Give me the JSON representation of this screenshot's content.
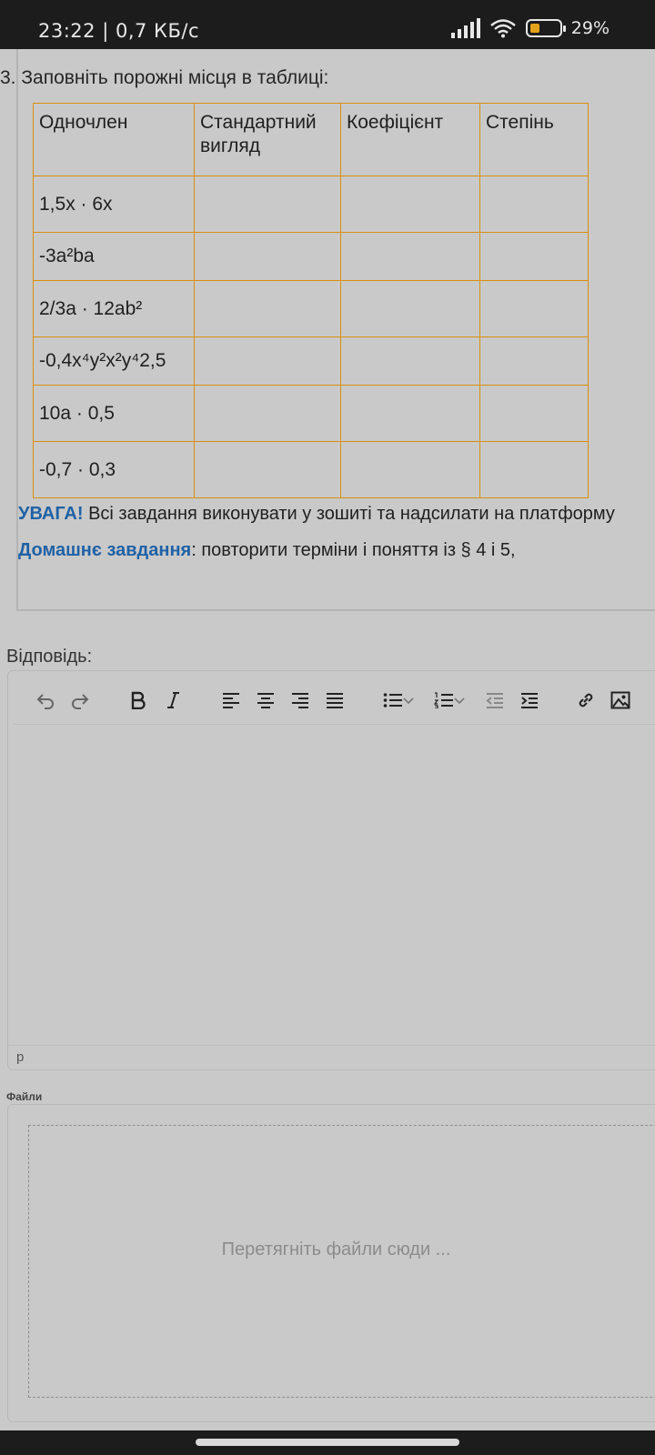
{
  "status_bar": {
    "time": "23:22",
    "separator": "|",
    "speed": "0,7 КБ/с",
    "battery": "29%"
  },
  "task": {
    "title": "3. Заповніть порожні місця в таблиці:",
    "headers": [
      "Одночлен",
      "Стандартний вигляд",
      "Коефіцієнт",
      "Степінь"
    ],
    "rows": [
      "1,5x · 6x",
      "-3a²ba",
      "2/3a · 12ab²",
      "-0,4x⁴y²x²y⁴2,5",
      "10a · 0,5",
      "-0,7 · 0,3"
    ],
    "warning_label": "УВАГА!",
    "warning_text": " Всі завдання виконувати у зошиті та надсилати на платформу",
    "homework_label": "Домашнє завдання",
    "homework_text": ":  повторити  терміни і поняття із  § 4 і 5,"
  },
  "answer": {
    "label": "Відповідь:",
    "path_text": "p"
  },
  "files": {
    "label": "Файли",
    "drop_text": "Перетягніть файли сюди ..."
  },
  "toolbar_icons": [
    "undo-icon",
    "redo-icon",
    "bold-icon",
    "italic-icon",
    "align-left-icon",
    "align-center-icon",
    "align-right-icon",
    "align-justify-icon",
    "bullet-list-icon",
    "numbered-list-icon",
    "outdent-icon",
    "indent-icon",
    "link-icon",
    "image-icon"
  ],
  "colors": {
    "table_border": "#d8900f",
    "accent_blue": "#1f62a6"
  }
}
